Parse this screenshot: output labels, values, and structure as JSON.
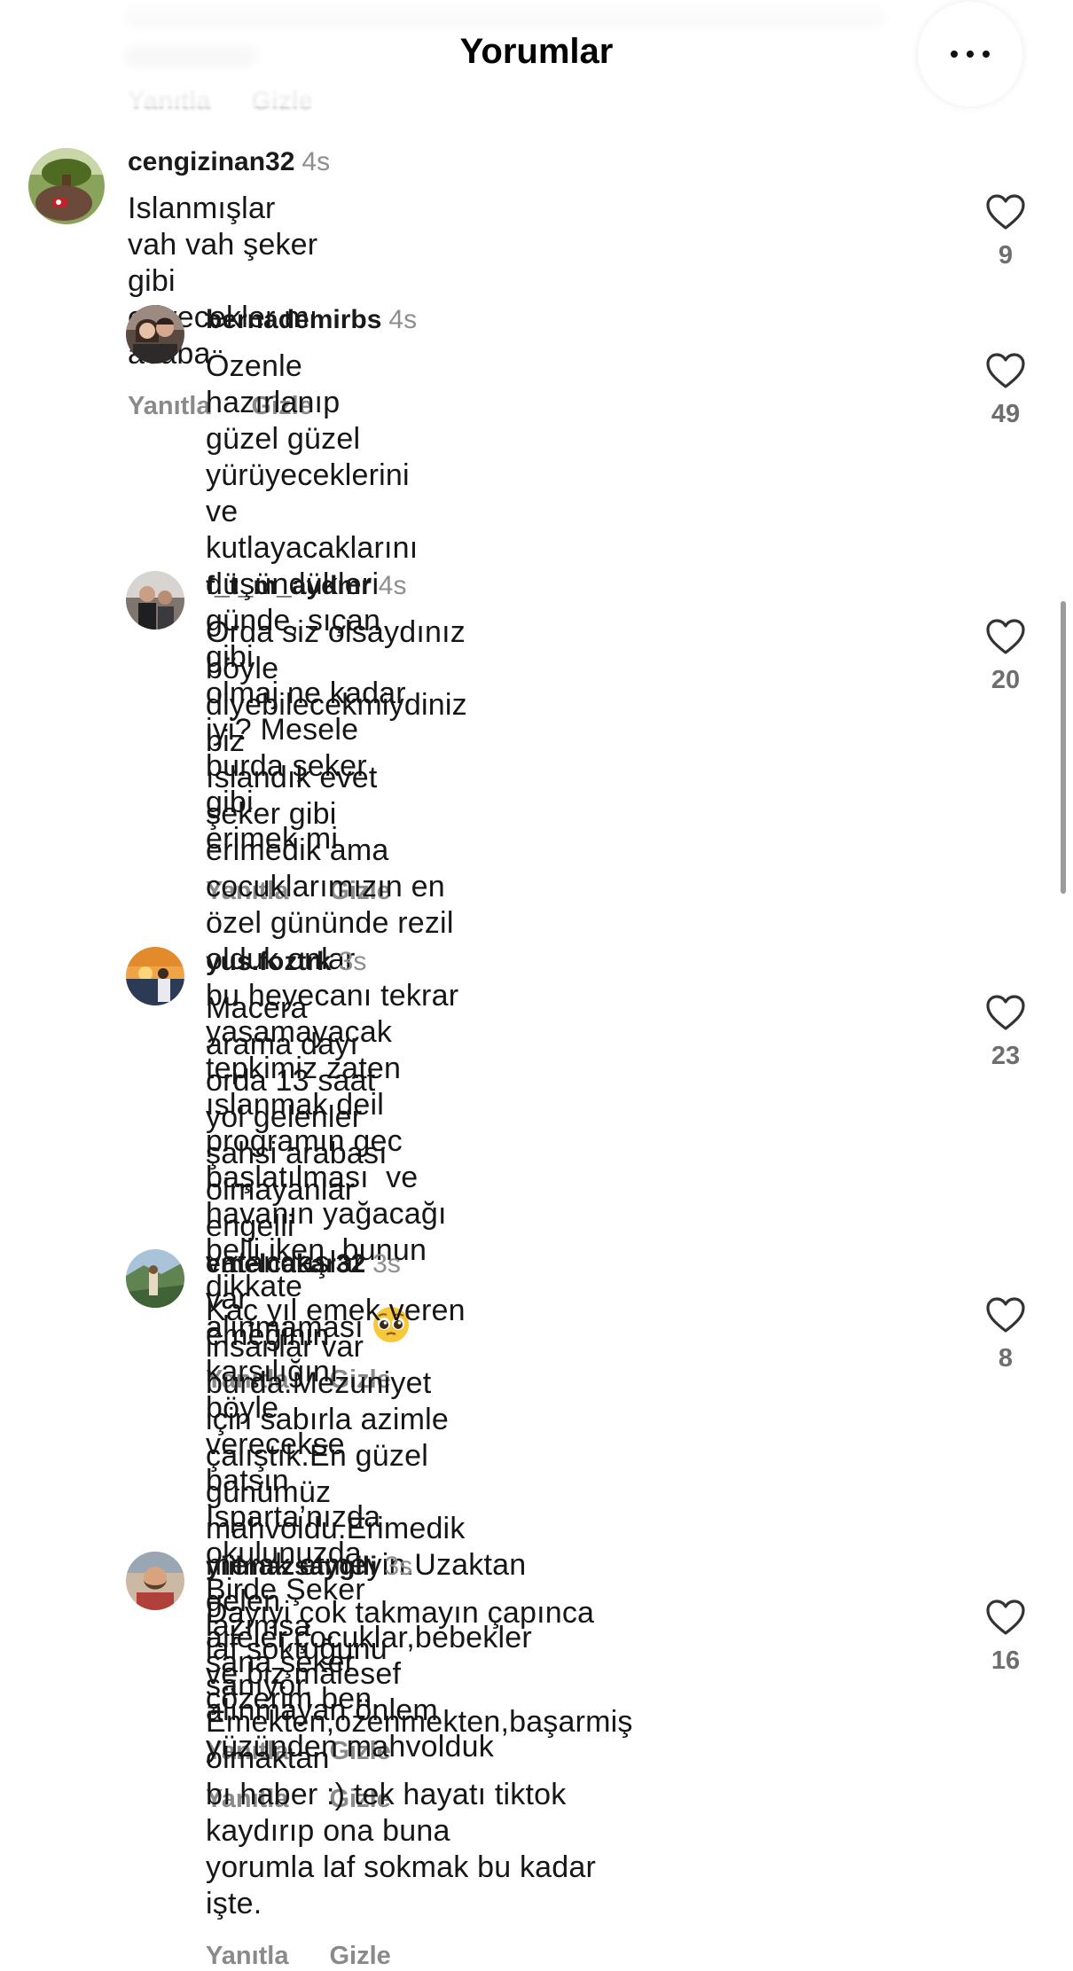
{
  "header": {
    "title": "Yorumlar",
    "more_icon": "ellipsis-icon"
  },
  "previous_comment": {
    "reply_label": "Yanıtla",
    "hide_label": "Gizle"
  },
  "comments": [
    {
      "username": "cengizinan32",
      "time": "4s",
      "text": "Islanmışlar vah vah şeker gibi eriyecekler mı acaba",
      "reply_label": "Yanıtla",
      "hide_label": "Gizle",
      "likes": "9",
      "avatar_color": "#5c6e2e"
    },
    {
      "username": "bernademirbs",
      "time": "4s",
      "text": "Özenle hazırlanıp güzel güzel yürüyeceklerini ve\nkutlayacaklarını düşündükleri günde, sıçan gibi\nolmaj ne kadar iyi? Mesele burda şeker gibi\nerimek mi",
      "reply_label": "Yanıtla",
      "hide_label": "Gizle",
      "likes": "49",
      "avatar_color": "#5a4a42"
    },
    {
      "username": "f_t_m_aydmr",
      "time": "4s",
      "text": "Orda siz olsaydınız böyle diyebilecekmiydiniz  biz\nıslandık evet  şeker gibi  erimedik ama\ncocuklarımızın en özel gününde rezil olduk onlar\nbu heyecanı tekrar yasamayacak  tepkimiz zaten\nıslanmak deil programın gec başlatılması  ve\nhavanın yağacağı belli iken  bunun dikkate\nalınmaması ",
      "emoji": "pleading-face-emoji",
      "reply_label": "Yanıtla",
      "hide_label": "Gizle",
      "likes": "20",
      "avatar_color": "#8f8a86"
    },
    {
      "username": "yus.foztrk",
      "time": "3s",
      "text": "Macera arama dayı orda 13 saat yol gelenler\nşahsi arabası olmayanlar engelli vatandaşlar var\nemeğinin karşılığını böyle verecekse batsın\nIsparta’nızda okulunuzda. Birde Şeker lazımsa\nsana şeker çözerim ben.",
      "reply_label": "Yanıtla",
      "hide_label": "Gizle",
      "likes": "23",
      "avatar_color": "#d9822b"
    },
    {
      "username": "emelcakar32",
      "time": "3s",
      "text": "Kaç yıl emek veren insanlar var burda.Mezuniyet\niçin sabırla azimle çalıştık.En güzel günümüz\nmahvoldu.Erimedik merak etmeyin.Uzaktan gelen\naileler,çocuklar,bebekler ve biz malesef\nalınmayan önlem yüzünden mahvolduk",
      "reply_label": "Yanıtla",
      "hide_label": "Gizle",
      "likes": "8",
      "avatar_color": "#6f8f6a"
    },
    {
      "username": "yiilmazsaygili",
      "time": "3s",
      "text": "Dayıyi çok takmayın çapınca laf soktuğunu\nsanıyor. Emekten,ozenmekten,başarmiş olmaktan\nbı haber :) tek hayatı tiktok kaydırıp ona buna\nyorumla laf sokmak bu kadar işte.",
      "reply_label": "Yanıtla",
      "hide_label": "Gizle",
      "likes": "16",
      "avatar_color": "#b98a6a"
    }
  ]
}
